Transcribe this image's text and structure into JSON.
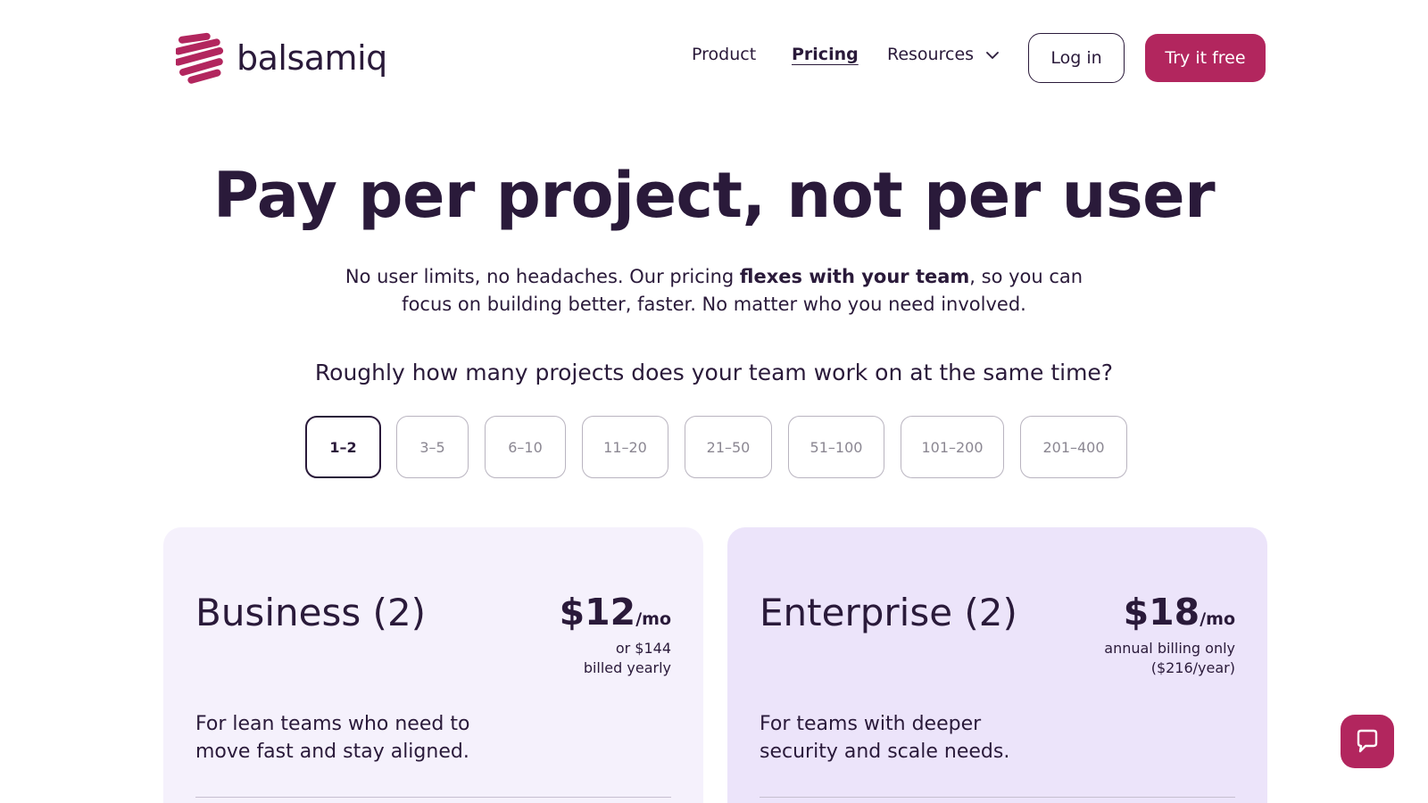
{
  "header": {
    "logo_text": "balsamiq",
    "nav": {
      "product": "Product",
      "pricing": "Pricing",
      "resources": "Resources"
    },
    "login_label": "Log in",
    "try_label": "Try it free"
  },
  "hero": {
    "title": "Pay per project, not per user",
    "subtitle_part1": "No user limits, no headaches. Our pricing ",
    "subtitle_bold": "flexes with your team",
    "subtitle_part2": ", so you can focus on building better, faster. No matter who you need involved."
  },
  "selector": {
    "question": "Roughly how many projects does your team work on at the same time?",
    "options": [
      "1–2",
      "3–5",
      "6–10",
      "11–20",
      "21–50",
      "51–100",
      "101–200",
      "201–400"
    ],
    "selected": "1–2"
  },
  "plans": [
    {
      "name": "Business (2)",
      "price": "$12",
      "unit": "/mo",
      "note_line1": "or $144",
      "note_line2": "billed yearly",
      "description": "For lean teams who need to move fast and stay aligned."
    },
    {
      "name": "Enterprise (2)",
      "price": "$18",
      "unit": "/mo",
      "note_line1": "annual billing only",
      "note_line2": "($216/year)",
      "description": "For teams with deeper security and scale needs."
    }
  ],
  "colors": {
    "brand": "#b2265e",
    "text": "#2a1a3a",
    "business_bg": "#f5f1fc",
    "enterprise_bg": "#ece4fa"
  },
  "icons": {
    "logo": "balsamiq-squiggle-logo",
    "resources_chevron": "chevron-down-icon",
    "help": "chat-bubble-icon"
  }
}
